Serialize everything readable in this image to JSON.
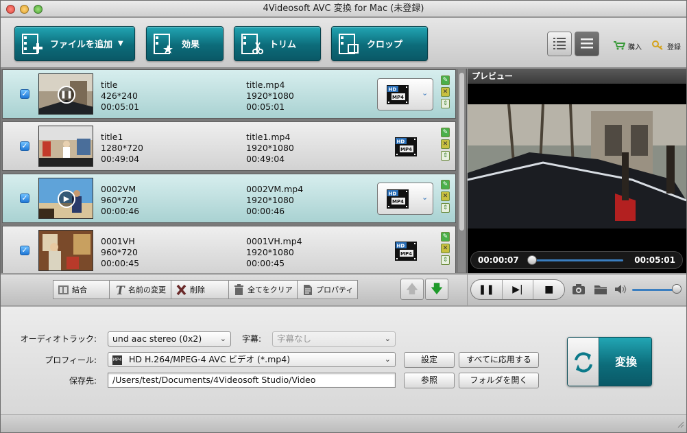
{
  "window": {
    "title": "4Videosoft AVC 変換 for Mac (未登録)"
  },
  "toolbar": {
    "add_file": "ファイルを追加",
    "effect": "効果",
    "trim": "トリム",
    "crop": "クロップ",
    "buy": "購入",
    "register": "登録"
  },
  "files": [
    {
      "name": "title",
      "resolution": "426*240",
      "duration": "00:05:01",
      "out_name": "title.mp4",
      "out_resolution": "1920*1080",
      "out_duration": "00:05:01",
      "selected": true
    },
    {
      "name": "title1",
      "resolution": "1280*720",
      "duration": "00:49:04",
      "out_name": "title1.mp4",
      "out_resolution": "1920*1080",
      "out_duration": "00:49:04",
      "selected": false
    },
    {
      "name": "0002VM",
      "resolution": "960*720",
      "duration": "00:00:46",
      "out_name": "0002VM.mp4",
      "out_resolution": "1920*1080",
      "out_duration": "00:00:46",
      "selected": true
    },
    {
      "name": "0001VH",
      "resolution": "960*720",
      "duration": "00:00:45",
      "out_name": "0001VH.mp4",
      "out_resolution": "1920*1080",
      "out_duration": "00:00:45",
      "selected": false
    }
  ],
  "format_badge": {
    "top": "HD",
    "bottom": "MP4"
  },
  "preview": {
    "title": "プレビュー",
    "current_time": "00:00:07",
    "total_time": "00:05:01",
    "progress": 0.02,
    "volume": 0.95
  },
  "edit": {
    "merge": "結合",
    "rename": "名前の変更",
    "delete": "削除",
    "clear_all": "全てをクリア",
    "properties": "プロパティ"
  },
  "settings": {
    "audio_label": "オーディオトラック:",
    "audio_value": "und aac stereo (0x2)",
    "subtitle_label": "字幕:",
    "subtitle_value": "字幕なし",
    "profile_label": "プロフィール:",
    "profile_value": "HD H.264/MPEG-4 AVC ビデオ (*.mp4)",
    "profile_icon_text": "MP4",
    "dest_label": "保存先:",
    "dest_value": "/Users/test/Documents/4Videosoft Studio/Video",
    "settings_btn": "設定",
    "apply_all_btn": "すべてに応用する",
    "browse_btn": "参照",
    "open_folder_btn": "フォルダを開く",
    "convert_btn": "変換"
  },
  "colors": {
    "accent": "#0c6c7a",
    "selected_row": "#bfe0e0"
  }
}
